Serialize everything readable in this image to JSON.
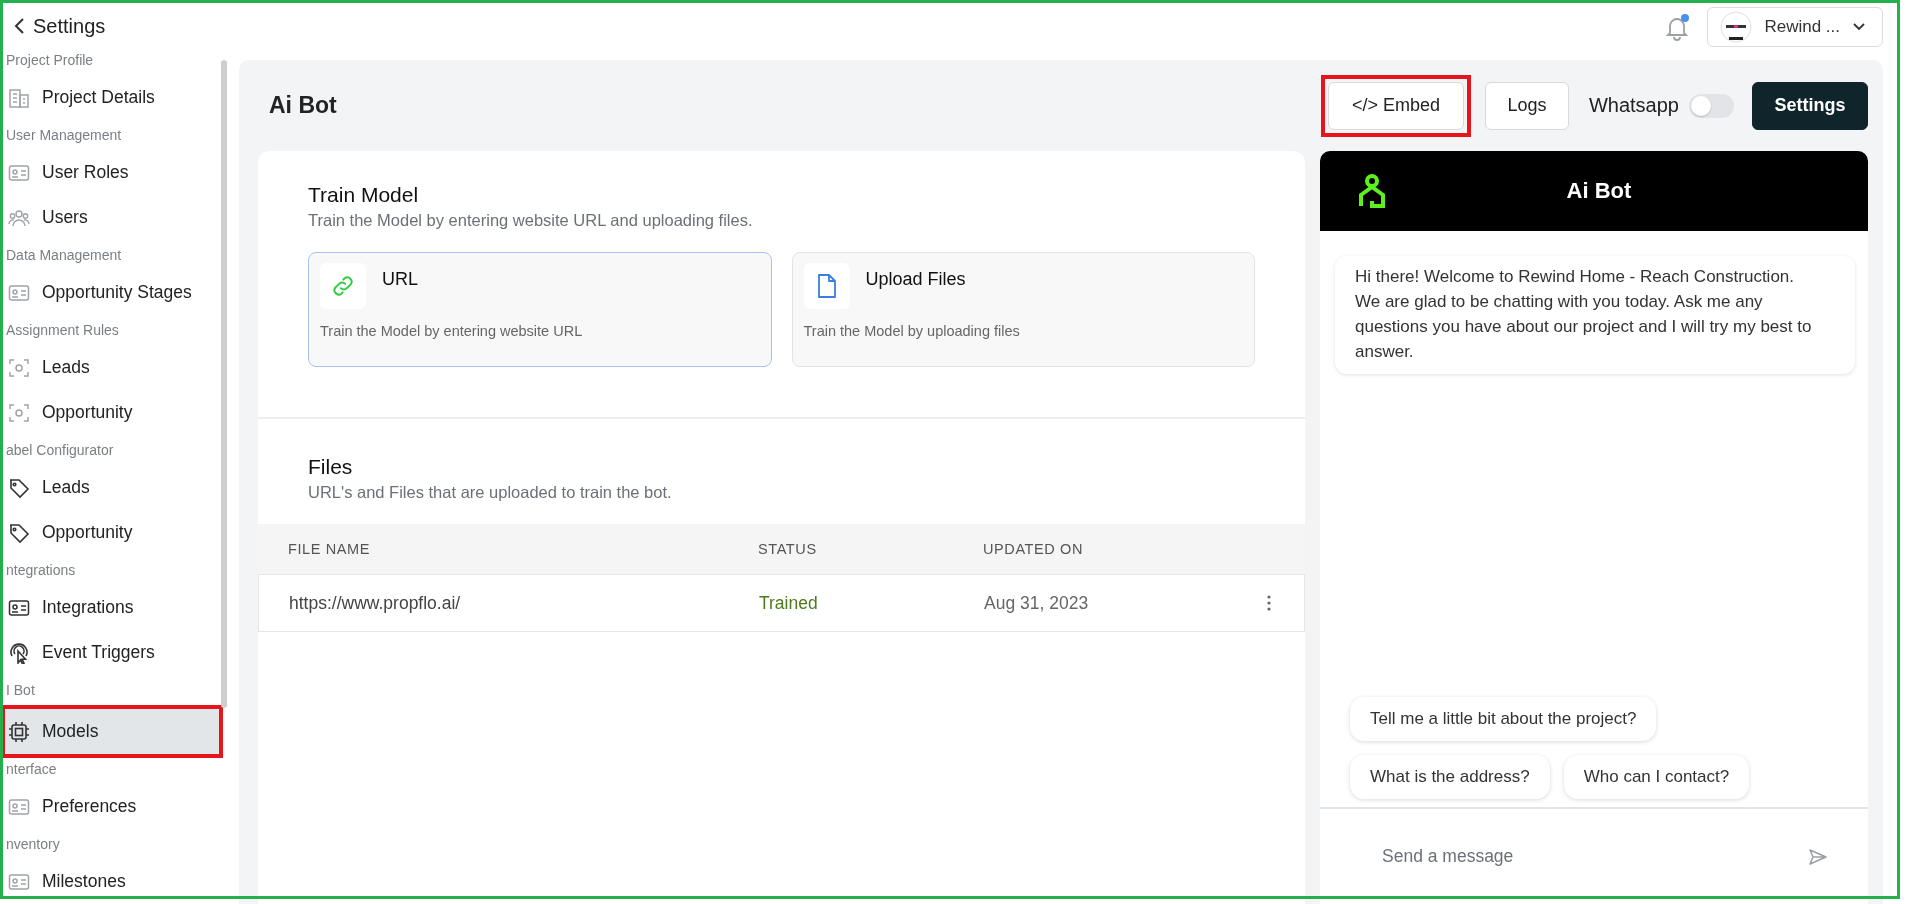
{
  "header": {
    "back_label": "Settings",
    "account": {
      "name": "Rewind ..."
    },
    "notification_dot": true
  },
  "sidebar": {
    "sections": [
      {
        "label": "Project Profile",
        "items": [
          {
            "label": "Project Details",
            "selected": false,
            "highlighted": false
          }
        ]
      },
      {
        "label": "User Management",
        "items": [
          {
            "label": "User Roles",
            "selected": false,
            "highlighted": false
          },
          {
            "label": "Users",
            "selected": false,
            "highlighted": false
          }
        ]
      },
      {
        "label": "Data Management",
        "items": [
          {
            "label": "Opportunity Stages",
            "selected": false,
            "highlighted": false
          }
        ]
      },
      {
        "label": "Assignment Rules",
        "items": [
          {
            "label": "Leads",
            "selected": false,
            "highlighted": false
          },
          {
            "label": "Opportunity",
            "selected": false,
            "highlighted": false
          }
        ]
      },
      {
        "label": "abel Configurator",
        "items": [
          {
            "label": "Leads",
            "selected": false,
            "highlighted": false
          },
          {
            "label": "Opportunity",
            "selected": false,
            "highlighted": false
          }
        ]
      },
      {
        "label": "ntegrations",
        "items": [
          {
            "label": "Integrations",
            "selected": false,
            "highlighted": false
          },
          {
            "label": "Event Triggers",
            "selected": false,
            "highlighted": false
          }
        ]
      },
      {
        "label": "I Bot",
        "items": [
          {
            "label": "Models",
            "selected": true,
            "highlighted": true
          }
        ]
      },
      {
        "label": "nterface",
        "items": [
          {
            "label": "Preferences",
            "selected": false,
            "highlighted": false
          }
        ]
      },
      {
        "label": "nventory",
        "items": [
          {
            "label": "Milestones",
            "selected": false,
            "highlighted": false
          }
        ]
      }
    ]
  },
  "page": {
    "title": "Ai Bot",
    "toolbar": {
      "embed": {
        "label": "</> Embed",
        "highlighted": true
      },
      "logs": {
        "label": "Logs"
      },
      "whatsapp": {
        "label": "Whatsapp",
        "on": false
      },
      "settings": {
        "label": "Settings"
      }
    }
  },
  "train_model": {
    "title": "Train Model",
    "subtitle": "Train the Model by entering website URL and uploading files.",
    "options": [
      {
        "title": "URL",
        "description": "Train the Model by entering website URL",
        "selected": true
      },
      {
        "title": "Upload Files",
        "description": "Train the Model by uploading files",
        "selected": false
      }
    ]
  },
  "files": {
    "title": "Files",
    "subtitle": "URL's and Files that are uploaded to train the bot.",
    "table": {
      "columns": [
        "FILE NAME",
        "STATUS",
        "UPDATED ON"
      ],
      "rows": [
        {
          "file_name": "https://www.propflo.ai/",
          "status": "Trained",
          "updated_on": "Aug 31, 2023"
        }
      ]
    }
  },
  "chat": {
    "title": "Ai Bot",
    "messages": [
      {
        "text": "Hi there! Welcome to Rewind Home - Reach Construction. We are glad to be chatting with you today. Ask me any questions you have about our project and I will try my best to answer."
      }
    ],
    "suggestions": [
      "Tell me a little bit about the project?",
      "What is the address?",
      "Who can I contact?"
    ],
    "input": {
      "placeholder": "Send a message"
    }
  }
}
